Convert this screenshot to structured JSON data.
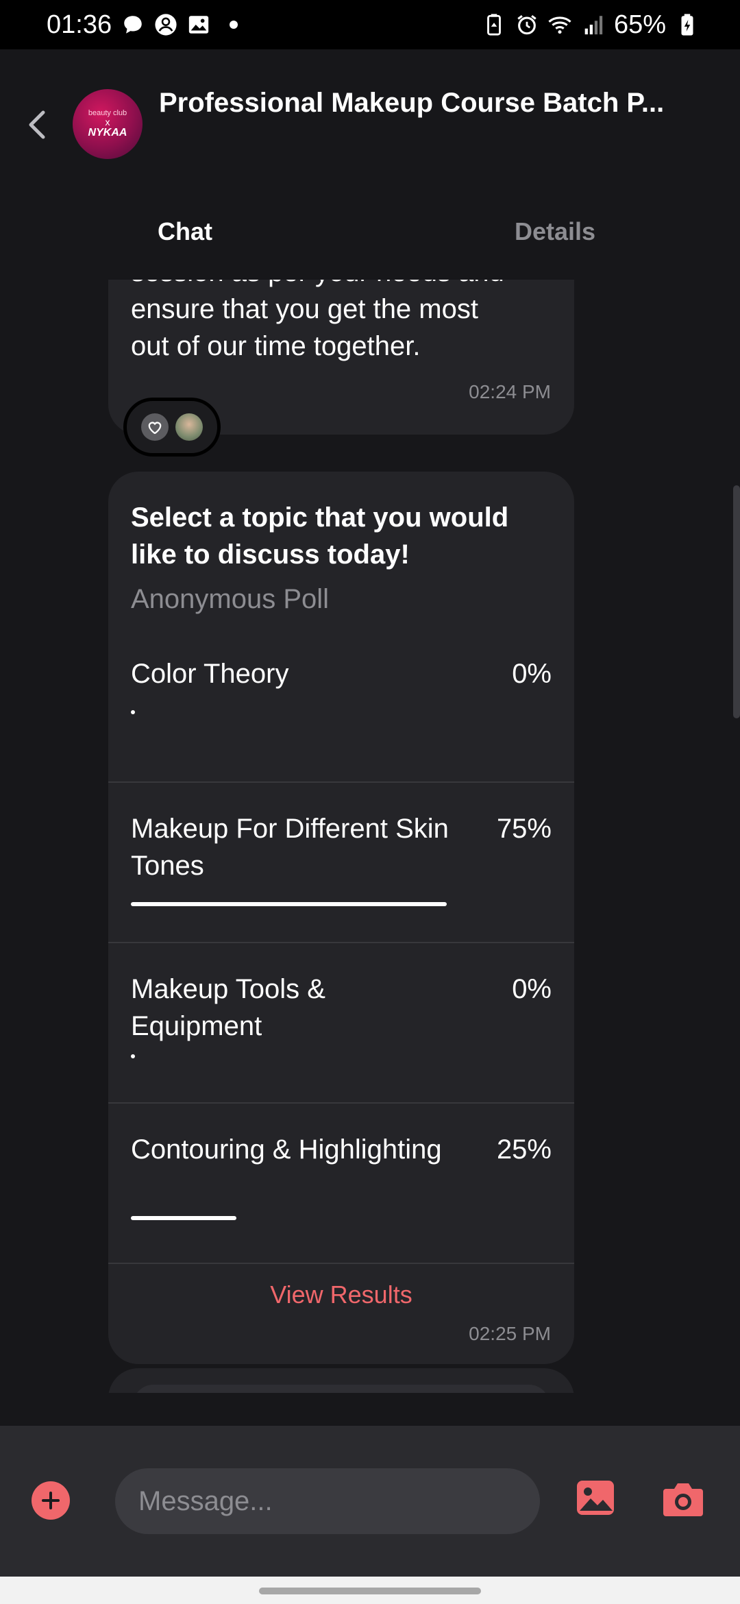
{
  "status_bar": {
    "time": "01:36",
    "battery": "65%"
  },
  "header": {
    "title": "Professional Makeup Course Batch P...",
    "avatar_text": {
      "line1": "beauty club",
      "line2": "x",
      "line3": "NYKAA"
    }
  },
  "tabs": [
    {
      "label": "Chat",
      "active": true
    },
    {
      "label": "Details",
      "active": false
    }
  ],
  "previous_message": {
    "lines": [
      "session as per your needs and",
      "ensure that you get the most",
      "out of our time together."
    ],
    "time": "02:24 PM"
  },
  "poll": {
    "question": "Select a topic that you would like to discuss today!",
    "type_label": "Anonymous Poll",
    "options": [
      {
        "label": "Color Theory",
        "percent_label": "0%",
        "percent": 0
      },
      {
        "label": "Makeup For Different Skin Tones",
        "percent_label": "75%",
        "percent": 75
      },
      {
        "label": "Makeup Tools & Equipment",
        "percent_label": "0%",
        "percent": 0
      },
      {
        "label": "Contouring & Highlighting",
        "percent_label": "25%",
        "percent": 25
      }
    ],
    "view_results_label": "View Results",
    "time": "02:25 PM"
  },
  "composer": {
    "placeholder": "Message..."
  },
  "colors": {
    "accent": "#f0676b",
    "background": "#17171a",
    "bubble": "#242428",
    "muted_text": "#8d8d92"
  },
  "icons": [
    "chat-bubble-icon",
    "person-icon",
    "image-icon",
    "battery-saver-icon",
    "alarm-icon",
    "wifi-icon",
    "signal-icon",
    "battery-icon",
    "back-arrow-icon",
    "heart-icon",
    "plus-icon",
    "gallery-icon",
    "camera-icon"
  ]
}
